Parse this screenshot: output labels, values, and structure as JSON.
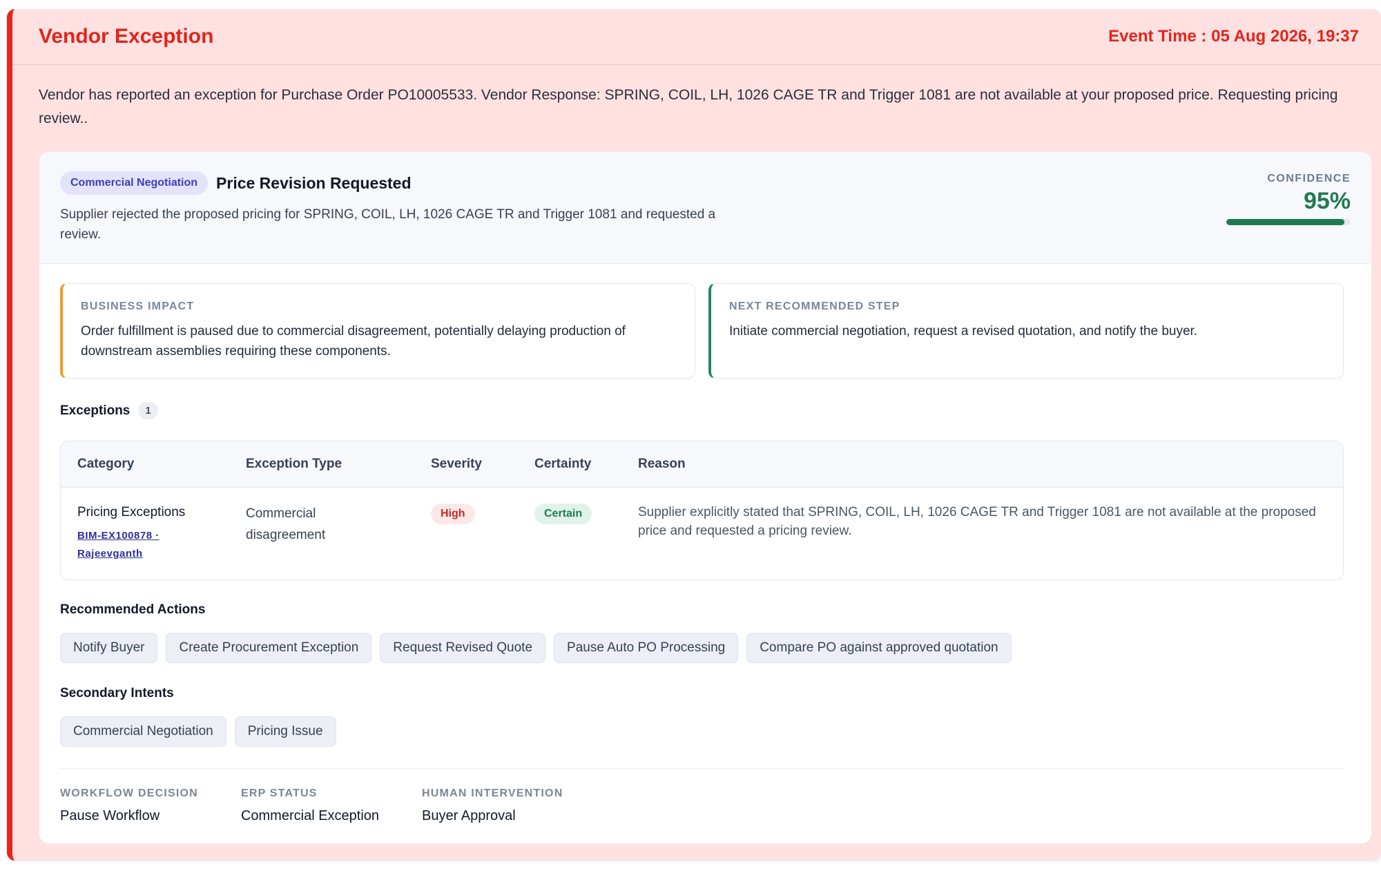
{
  "header": {
    "title": "Vendor Exception",
    "event_time": "Event Time : 05 Aug 2026, 19:37"
  },
  "message": "Vendor has reported an exception for Purchase Order PO10005533. Vendor Response: SPRING, COIL, LH, 1026 CAGE TR and Trigger 1081 are not available at your proposed price. Requesting pricing review..",
  "summary": {
    "intent_pill": "Commercial Negotiation",
    "title": "Price Revision Requested",
    "description": "Supplier rejected the proposed pricing for SPRING, COIL, LH, 1026 CAGE TR and Trigger 1081 and requested a review.",
    "confidence_label": "CONFIDENCE",
    "confidence_value": "95%",
    "confidence_fraction": 0.95,
    "confidence_color": "#1f7a52"
  },
  "impact": {
    "label": "BUSINESS IMPACT",
    "text": "Order fulfillment is paused due to commercial disagreement, potentially delaying production of downstream assemblies requiring these components."
  },
  "next_step": {
    "label": "NEXT RECOMMENDED STEP",
    "text": "Initiate commercial negotiation, request a revised quotation, and notify the buyer."
  },
  "exceptions": {
    "title": "Exceptions",
    "count": "1",
    "columns": [
      "Category",
      "Exception Type",
      "Severity",
      "Certainty",
      "Reason"
    ],
    "rows": [
      {
        "category": "Pricing Exceptions",
        "link": "BIM-EX100878 · Rajeevganth",
        "type": "Commercial disagreement",
        "severity": "High",
        "certainty": "Certain",
        "reason": "Supplier explicitly stated that SPRING, COIL, LH, 1026 CAGE TR and Trigger 1081 are not available at the proposed price and requested a pricing review."
      }
    ]
  },
  "actions": {
    "title": "Recommended Actions",
    "items": [
      "Notify Buyer",
      "Create Procurement Exception",
      "Request Revised Quote",
      "Pause Auto PO Processing",
      "Compare PO against approved quotation"
    ]
  },
  "intents": {
    "title": "Secondary Intents",
    "items": [
      "Commercial Negotiation",
      "Pricing Issue"
    ]
  },
  "footer": {
    "workflow_label": "WORKFLOW DECISION",
    "workflow_value": "Pause Workflow",
    "erp_label": "ERP STATUS",
    "erp_value": "Commercial Exception",
    "human_label": "HUMAN INTERVENTION",
    "human_value": "Buyer Approval"
  },
  "colors": {
    "accent_red": "#e1251b",
    "panel_bg": "#ffe1e1",
    "impact_border": "#f29a1b",
    "next_border": "#1f8a5a"
  }
}
